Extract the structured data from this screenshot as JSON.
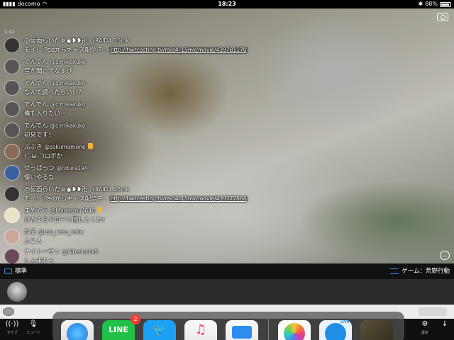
{
  "status_bar": {
    "carrier": "docomo",
    "time": "18:23",
    "battery": "88%"
  },
  "video": {
    "small_count": "1 ロ"
  },
  "comments": [
    {
      "name": "@仮面らいだぁ◉❥❥卍",
      "uid": "@RAID4_15mk",
      "message": "モイ！iPadからキャス配信中 - ",
      "link": "http://twitcasting.tv/raid4_15mk/movie/439781170",
      "medal": false
    },
    {
      "name": "でんでん",
      "uid": "@c:mikakuko",
      "message": "音が聞こえなすぴ",
      "link": "",
      "medal": false
    },
    {
      "name": "でんでん",
      "uid": "@c:mikakuko",
      "message": "なんて調べたらいい？",
      "link": "",
      "medal": false
    },
    {
      "name": "でんでん",
      "uid": "@c:mikakuko",
      "message": "俺も入りたいー",
      "link": "",
      "medal": false
    },
    {
      "name": "でんでん",
      "uid": "@c:mikakuko",
      "message": "初見です！",
      "link": "",
      "medal": false
    },
    {
      "name": "ふぶき",
      "uid": "@sakumamone",
      "message": "(´-ω-`)ロボか",
      "link": "",
      "medal": true
    },
    {
      "name": "せっぱっつ",
      "uid": "@ridura194",
      "message": "懐いやるな",
      "link": "",
      "medal": false
    },
    {
      "name": "@仮面らいだぁ◉❥❥卍",
      "uid": "@RAID4_15mk",
      "message": "モイ！iPadからキャス配信中 - ",
      "link": "http://twitcasting.tv/raid4_15mk/movie/439777866",
      "medal": false
    },
    {
      "name": "まめぞう",
      "uid": "@Mamezou4646",
      "message": "ひたすらドローン回しとくわ！",
      "link": "",
      "medal": true
    },
    {
      "name": "ねる",
      "uid": "@uso_nero_neko",
      "message": "上２人",
      "link": "",
      "medal": false
    },
    {
      "name": "ナイトーサン",
      "uid": "@Alterius1x9",
      "message": "しゃまむぅ",
      "link": "",
      "medal": false
    }
  ],
  "info_bar": {
    "quality": "標準",
    "game": "ゲーム：荒野行動"
  },
  "toolbar": {
    "live_label": "ライブ",
    "mute_label": "ミュート",
    "settings_label": "設定"
  },
  "dock": {
    "line_label": "LINE",
    "line_badge": "2",
    "live_tag": "LIVE"
  }
}
